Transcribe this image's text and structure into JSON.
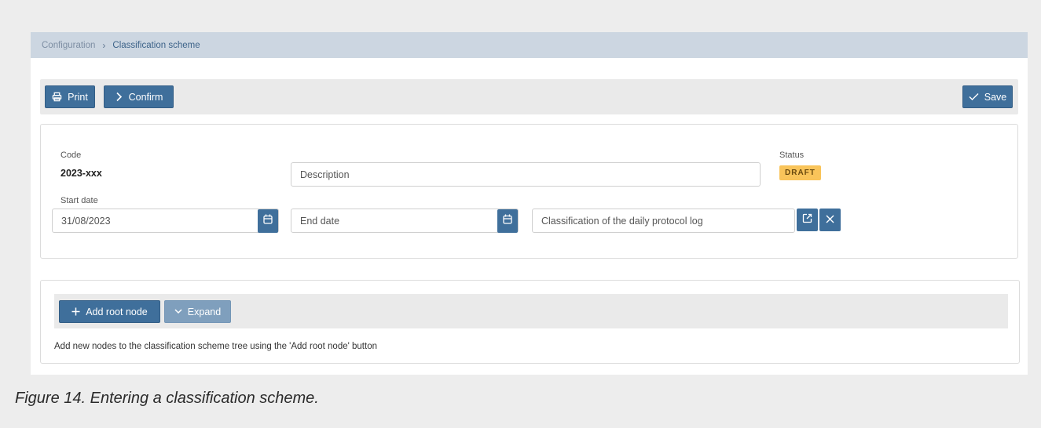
{
  "breadcrumb": {
    "items": [
      "Configuration",
      "Classification scheme"
    ],
    "separator": "›"
  },
  "toolbar": {
    "print_label": "Print",
    "confirm_label": "Confirm",
    "save_label": "Save"
  },
  "form": {
    "code_label": "Code",
    "code_value": "2023-xxx",
    "description_placeholder": "Description",
    "status_label": "Status",
    "status_value": "DRAFT",
    "start_date_label": "Start date",
    "start_date_value": "31/08/2023",
    "end_date_placeholder": "End date",
    "classification_value": "Classification of the daily protocol log"
  },
  "tree": {
    "add_root_label": "Add root node",
    "expand_label": "Expand",
    "hint": "Add new nodes to the classification scheme tree using the 'Add root node' button"
  },
  "caption": "Figure 14. Entering a classification scheme.",
  "colors": {
    "primary": "#3f6f9b",
    "primary_disabled": "#7f9fbd",
    "status_draft": "#f9c45a",
    "breadcrumb_bg": "#ccd6e1"
  },
  "icons": {
    "print": "printer-icon",
    "confirm": "chevron-right-icon",
    "save": "check-icon",
    "calendar": "calendar-icon",
    "open": "external-link-icon",
    "clear": "close-icon",
    "add": "plus-icon",
    "expand": "chevron-down-icon"
  }
}
